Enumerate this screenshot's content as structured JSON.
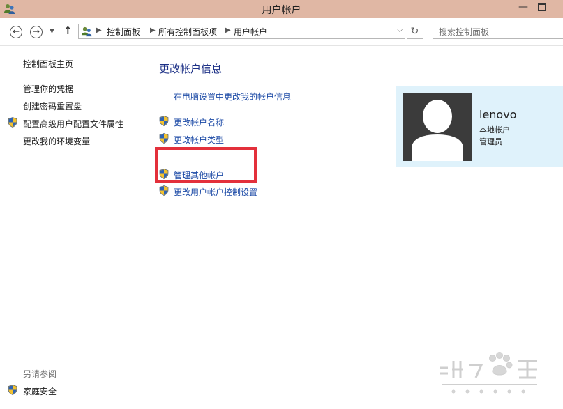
{
  "window": {
    "title": "用户帐户"
  },
  "nav": {
    "breadcrumb": [
      "控制面板",
      "所有控制面板项",
      "用户帐户"
    ],
    "search_placeholder": "搜索控制面板"
  },
  "sidebar": {
    "home": "控制面板主页",
    "items": [
      "管理你的凭据",
      "创建密码重置盘",
      "配置高级用户配置文件属性",
      "更改我的环境变量"
    ],
    "see_also_heading": "另请参阅",
    "see_also_items": [
      "家庭安全"
    ]
  },
  "main": {
    "title": "更改帐户信息",
    "pc_settings_link": "在电脑设置中更改我的帐户信息",
    "links_group1": [
      "更改帐户名称",
      "更改帐户类型"
    ],
    "links_group2": [
      "管理其他帐户",
      "更改用户帐户控制设置"
    ]
  },
  "account": {
    "name": "lenovo",
    "type": "本地帐户",
    "role": "管理员"
  },
  "colors": {
    "titlebar": "#e0b7a4",
    "link": "#1c4aa6",
    "title": "#1e3287",
    "tile_bg": "#dff2fb",
    "highlight": "#e3303b"
  }
}
